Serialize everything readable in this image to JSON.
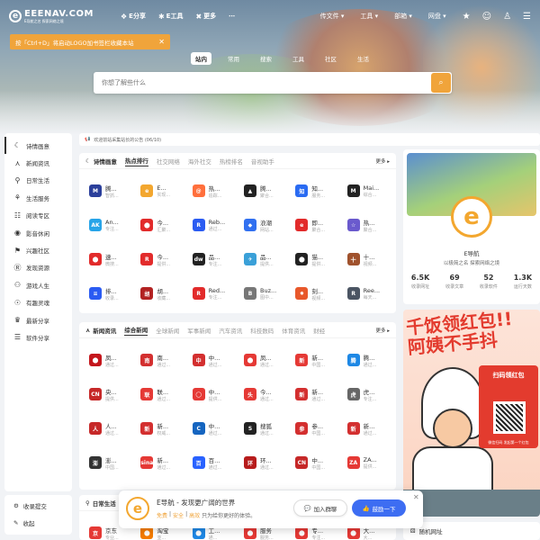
{
  "brand": {
    "name": "EEENAV.COM",
    "tagline": "E导航之名 探索网络之境",
    "mark": "e"
  },
  "nav": [
    {
      "icon": "❖",
      "label": "E分享"
    },
    {
      "icon": "✱",
      "label": "E工具"
    },
    {
      "icon": "✖",
      "label": "更多"
    },
    {
      "icon": "",
      "label": "⋯"
    }
  ],
  "rightnav": [
    {
      "label": "传文件 ▾"
    },
    {
      "label": "工具 ▾"
    },
    {
      "label": "部箱 ▾"
    },
    {
      "label": "网盘 ▾"
    }
  ],
  "notice": {
    "text": "按「Ctrl+D」将启动LOGO加书签栏收藏本站",
    "close": "✕"
  },
  "search_tabs": [
    {
      "label": "站内",
      "on": true
    },
    {
      "label": "常用",
      "on": false
    },
    {
      "label": "搜索",
      "on": false
    },
    {
      "label": "工具",
      "on": false
    },
    {
      "label": "社区",
      "on": false
    },
    {
      "label": "生活",
      "on": false
    }
  ],
  "search": {
    "placeholder": "你想了解些什么"
  },
  "announcement": "欢迎前站采集站长的公告 (06/10)",
  "sidebar": [
    {
      "icon": "☾",
      "label": "诗情画意"
    },
    {
      "icon": "⋏",
      "label": "新闻资讯"
    },
    {
      "icon": "⚲",
      "label": "日常生活"
    },
    {
      "icon": "⚘",
      "label": "生活服务"
    },
    {
      "icon": "☷",
      "label": "阅读专区"
    },
    {
      "icon": "◉",
      "label": "影音休闲"
    },
    {
      "icon": "⚑",
      "label": "兴趣社区"
    },
    {
      "icon": "Ⓡ",
      "label": "发现资源"
    },
    {
      "icon": "⚇",
      "label": "游戏人生"
    },
    {
      "icon": "☉",
      "label": "有趣灵魂"
    },
    {
      "icon": "♛",
      "label": "最新分享"
    },
    {
      "icon": "☰",
      "label": "软件分享"
    }
  ],
  "sidebottom": [
    {
      "icon": "⚙",
      "label": "收录提交"
    },
    {
      "icon": "✎",
      "label": "收起"
    }
  ],
  "section1": {
    "title": "诗情画意",
    "tabs": [
      {
        "label": "热点排行",
        "on": true
      },
      {
        "label": "社交网络"
      },
      {
        "label": "海外社交"
      },
      {
        "label": "热榜排名"
      },
      {
        "label": "音视助手"
      }
    ],
    "more": "更多 ▸",
    "items": [
      {
        "l": "M",
        "c": "#2b3f9b",
        "t": "腾...",
        "s": "智抓..."
      },
      {
        "l": "e",
        "c": "#f3a72f",
        "t": "E...",
        "s": "实现..."
      },
      {
        "l": "@",
        "c": "#ff6f3c",
        "t": "热...",
        "s": "追踪..."
      },
      {
        "l": "▲",
        "c": "#222",
        "t": "腾...",
        "s": "聚合..."
      },
      {
        "l": "知",
        "c": "#2a6bf2",
        "t": "知...",
        "s": "服务..."
      },
      {
        "l": "M",
        "c": "#222",
        "t": "Mai...",
        "s": "综合..."
      },
      {
        "l": "AK",
        "c": "#27a4e8",
        "t": "An...",
        "s": "专注..."
      },
      {
        "l": "⬤",
        "c": "#e22b2b",
        "t": "今...",
        "s": "汇聚..."
      },
      {
        "l": "R",
        "c": "#2a5bf2",
        "t": "Reb...",
        "s": "通过..."
      },
      {
        "l": "◆",
        "c": "#3170f0",
        "t": "浪潮",
        "s": "网站..."
      },
      {
        "l": "e",
        "c": "#e22b2b",
        "t": "即...",
        "s": "聚合..."
      },
      {
        "l": "☆",
        "c": "#6a5acd",
        "t": "热...",
        "s": "聚合..."
      },
      {
        "l": "⬤",
        "c": "#e22b2b",
        "t": "速...",
        "s": "微搜..."
      },
      {
        "l": "R",
        "c": "#e22b2b",
        "t": "今...",
        "s": "提供..."
      },
      {
        "l": "dw",
        "c": "#222",
        "t": "品...",
        "s": "专注..."
      },
      {
        "l": "✈",
        "c": "#3aa0d8",
        "t": "品...",
        "s": "提供..."
      },
      {
        "l": "⬤",
        "c": "#222",
        "t": "猫...",
        "s": "提供..."
      },
      {
        "l": "十",
        "c": "#a0522d",
        "t": "十...",
        "s": "视频..."
      },
      {
        "l": "≡",
        "c": "#2a5bf2",
        "t": "排...",
        "s": "收录..."
      },
      {
        "l": "胡",
        "c": "#b22222",
        "t": "胡...",
        "s": "收藏..."
      },
      {
        "l": "R",
        "c": "#e22b2b",
        "t": "Red...",
        "s": "专注..."
      },
      {
        "l": "B",
        "c": "#777",
        "t": "Buz...",
        "s": "图中..."
      },
      {
        "l": "✸",
        "c": "#e8582b",
        "t": "刻...",
        "s": "视频..."
      },
      {
        "l": "R",
        "c": "#4b5563",
        "t": "Ree...",
        "s": "每天..."
      }
    ]
  },
  "section2": {
    "title": "新闻资讯",
    "tabs": [
      {
        "label": "综合新闻",
        "on": true
      },
      {
        "label": "全球新闻"
      },
      {
        "label": "军事新闻"
      },
      {
        "label": "汽车资讯"
      },
      {
        "label": "科技数码"
      },
      {
        "label": "体育资讯"
      },
      {
        "label": "财经"
      }
    ],
    "more": "更多 ▸",
    "items": [
      {
        "l": "⬤",
        "c": "#c4161c",
        "t": "凤...",
        "s": "通过..."
      },
      {
        "l": "南",
        "c": "#d32f2f",
        "t": "南...",
        "s": "通过..."
      },
      {
        "l": "中",
        "c": "#d32f2f",
        "t": "中...",
        "s": "通过..."
      },
      {
        "l": "⬤",
        "c": "#e53935",
        "t": "凤...",
        "s": "通过..."
      },
      {
        "l": "新",
        "c": "#e53935",
        "t": "新...",
        "s": "中国..."
      },
      {
        "l": "腾",
        "c": "#1e88e5",
        "t": "腾...",
        "s": "通过..."
      },
      {
        "l": "CN",
        "c": "#c62828",
        "t": "央...",
        "s": "提供..."
      },
      {
        "l": "联",
        "c": "#e53935",
        "t": "联...",
        "s": "通过..."
      },
      {
        "l": "◯",
        "c": "#e53935",
        "t": "中...",
        "s": "提供..."
      },
      {
        "l": "头",
        "c": "#e53935",
        "t": "今...",
        "s": "通过..."
      },
      {
        "l": "新",
        "c": "#d32f2f",
        "t": "新...",
        "s": "通过..."
      },
      {
        "l": "虎",
        "c": "#666",
        "t": "虎...",
        "s": "专注..."
      },
      {
        "l": "人",
        "c": "#c62828",
        "t": "人...",
        "s": "通过..."
      },
      {
        "l": "新",
        "c": "#d32f2f",
        "t": "新...",
        "s": "权威..."
      },
      {
        "l": "C",
        "c": "#1565c0",
        "t": "中...",
        "s": "通过..."
      },
      {
        "l": "S",
        "c": "#222",
        "t": "搜狐",
        "s": "通过..."
      },
      {
        "l": "参",
        "c": "#d32f2f",
        "t": "参...",
        "s": "中国..."
      },
      {
        "l": "新",
        "c": "#d32f2f",
        "t": "新...",
        "s": "通过..."
      },
      {
        "l": "澎",
        "c": "#333",
        "t": "澎...",
        "s": "中国..."
      },
      {
        "l": "sina",
        "c": "#e53935",
        "t": "新...",
        "s": "通过..."
      },
      {
        "l": "百",
        "c": "#2962ff",
        "t": "百...",
        "s": "通过..."
      },
      {
        "l": "环",
        "c": "#b71c1c",
        "t": "环...",
        "s": "通过..."
      },
      {
        "l": "CN",
        "c": "#c62828",
        "t": "中...",
        "s": "中国..."
      },
      {
        "l": "ZA",
        "c": "#e53935",
        "t": "ZA...",
        "s": "提供..."
      }
    ]
  },
  "section3": {
    "title": "日常生活",
    "items": [
      {
        "l": "京",
        "c": "#e53935",
        "t": "京东",
        "s": "专业..."
      },
      {
        "l": "⬤",
        "c": "#f57c00",
        "t": "淘宝",
        "s": "亚..."
      },
      {
        "l": "⬤",
        "c": "#1e88e5",
        "t": "工...",
        "s": "通..."
      },
      {
        "l": "⬤",
        "c": "#e53935",
        "t": "服务",
        "s": "服务..."
      },
      {
        "l": "⬤",
        "c": "#e53935",
        "t": "专...",
        "s": "专注..."
      },
      {
        "l": "⬤",
        "c": "#e53935",
        "t": "大...",
        "s": "大..."
      }
    ]
  },
  "profile": {
    "name": "E导航",
    "slogan": "以极简之名 探索网络之境",
    "avatar": "e",
    "stats": [
      {
        "v": "6.5K",
        "l": "收录网址"
      },
      {
        "v": "69",
        "l": "收录文章"
      },
      {
        "v": "52",
        "l": "收录软件"
      },
      {
        "v": "1.3K",
        "l": "运行天数"
      }
    ]
  },
  "ad": {
    "headline1": "千饭领红包!!",
    "headline2": "阿姨不手抖",
    "poster_title": "扫码领红包",
    "poster_sub": "微信扫码 发起第一个红包"
  },
  "random": {
    "icon": "⚄",
    "label": "随机网址"
  },
  "popup": {
    "logo": "e",
    "title": "E导航 - 发现更广阔的世界",
    "badges": [
      "免费",
      "安全",
      "高效"
    ],
    "desc": "只为给你更好的体验。",
    "join": "加入群聊",
    "join_icon": "💬",
    "start": "鼓励一下",
    "start_icon": "👍",
    "close": "✕"
  },
  "colors": {
    "accent": "#f0a43b",
    "primary_blue": "#3d6df2"
  }
}
